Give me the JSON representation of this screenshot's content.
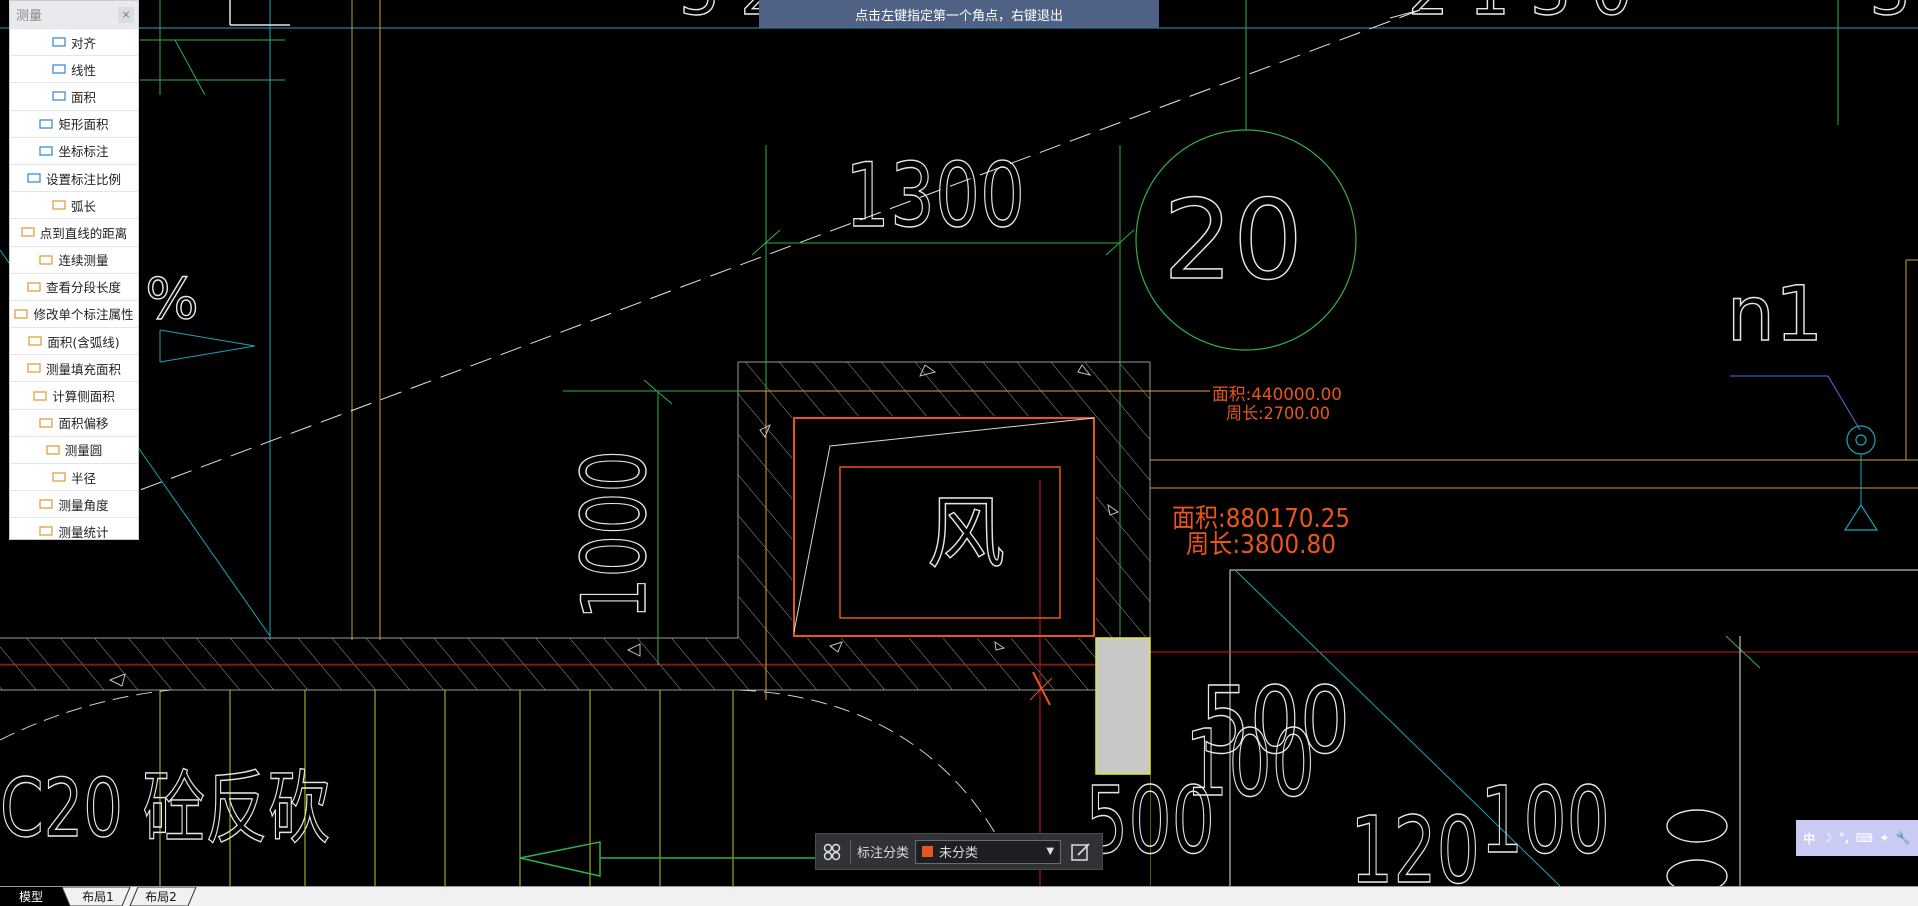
{
  "status_banner": "点击左键指定第一个角点，右键退出",
  "measure_panel": {
    "title": "测量",
    "close_label": "×",
    "tools": [
      {
        "label": "对齐",
        "icon": "align-measure-icon"
      },
      {
        "label": "线性",
        "icon": "linear-measure-icon"
      },
      {
        "label": "面积",
        "icon": "area-icon"
      },
      {
        "label": "矩形面积",
        "icon": "rect-area-icon"
      },
      {
        "label": "坐标标注",
        "icon": "coordinate-icon"
      },
      {
        "label": "设置标注比例",
        "icon": "scale-icon"
      },
      {
        "label": "弧长",
        "icon": "arc-length-icon"
      },
      {
        "label": "点到直线的距离",
        "icon": "point-line-distance-icon"
      },
      {
        "label": "连续测量",
        "icon": "continuous-measure-icon"
      },
      {
        "label": "查看分段长度",
        "icon": "segment-length-icon"
      },
      {
        "label": "修改单个标注属性",
        "icon": "edit-annotation-icon"
      },
      {
        "label": "面积(含弧线)",
        "icon": "arc-area-icon"
      },
      {
        "label": "测量填充面积",
        "icon": "fill-area-icon"
      },
      {
        "label": "计算侧面积",
        "icon": "side-area-icon"
      },
      {
        "label": "面积偏移",
        "icon": "area-offset-icon"
      },
      {
        "label": "测量圆",
        "icon": "circle-icon"
      },
      {
        "label": "半径",
        "icon": "radius-icon"
      },
      {
        "label": "测量角度",
        "icon": "angle-icon"
      },
      {
        "label": "测量统计",
        "icon": "statistics-icon"
      }
    ]
  },
  "drawing": {
    "dim_1300": "1300",
    "dim_1000": "1000",
    "circle_label": "20",
    "duct_label": "风",
    "n1_label": "n1",
    "percent_label": "%",
    "c20_label": "C20 砼反砍",
    "dim_500": "500",
    "dim_100": "100",
    "dim_500b": "500",
    "dim_100b": "100",
    "dim_120": "120",
    "dim_100c": "100",
    "top_fragment_left": "5 2",
    "top_fragment_right": "2 1 3 0",
    "top_fragment_far": "3",
    "side_fragment": "5",
    "measure1_area": "面积:440000.00",
    "measure1_perim": "周长:2700.00",
    "measure2_area": "面积:880170.25",
    "measure2_perim": "周长:3800.80"
  },
  "annotation_toolbar": {
    "category_label": "标注分类",
    "category_value": "未分类",
    "swatch_color": "#e8561d"
  },
  "ime_bar": {
    "lang": "中",
    "items": [
      "中",
      "☽",
      "°,",
      "⌨",
      "✦",
      "🔧"
    ]
  },
  "tabs": [
    {
      "label": "模型",
      "active": true
    },
    {
      "label": "布局1",
      "active": false
    },
    {
      "label": "布局2",
      "active": false
    }
  ],
  "colors": {
    "background": "#000000",
    "measure_text": "#e8561d",
    "cad_white": "#e6e6e6",
    "cad_green": "#2fb04a",
    "cad_yellow": "#c9c21e",
    "cad_orange": "#e0a040",
    "cad_cyan": "#1ba3b8",
    "cad_red": "#d01818"
  }
}
